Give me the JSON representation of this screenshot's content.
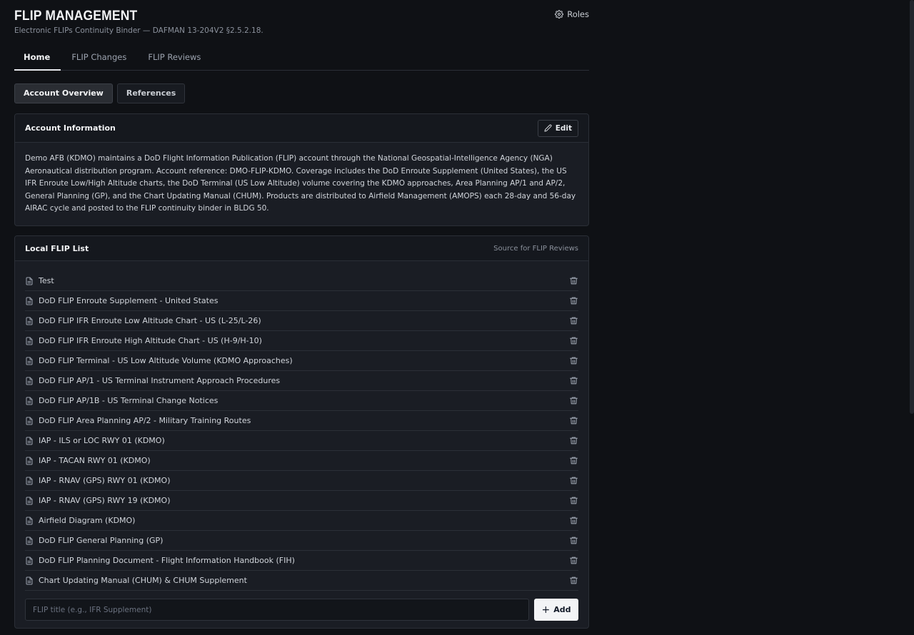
{
  "header": {
    "title": "FLIP MANAGEMENT",
    "subtitle": "Electronic FLIPs Continuity Binder — DAFMAN 13-204V2 §2.5.2.18.",
    "roles_label": "Roles"
  },
  "tabs": [
    {
      "label": "Home",
      "active": true
    },
    {
      "label": "FLIP Changes",
      "active": false
    },
    {
      "label": "FLIP Reviews",
      "active": false
    }
  ],
  "subtabs": [
    {
      "label": "Account Overview",
      "active": true
    },
    {
      "label": "References",
      "active": false
    }
  ],
  "account": {
    "title": "Account Information",
    "edit_label": "Edit",
    "text": "Demo AFB (KDMO) maintains a DoD Flight Information Publication (FLIP) account through the National Geospatial-Intelligence Agency (NGA) Aeronautical distribution program. Account reference: DMO-FLIP-KDMO. Coverage includes the DoD Enroute Supplement (United States), the US IFR Enroute Low/High Altitude charts, the DoD Terminal (US Low Altitude) volume covering the KDMO approaches, Area Planning AP/1 and AP/2, General Planning (GP), and the Chart Updating Manual (CHUM). Products are distributed to Airfield Management (AMOPS) each 28-day and 56-day AIRAC cycle and posted to the FLIP continuity binder in BLDG 50."
  },
  "flip_list": {
    "title": "Local FLIP List",
    "note": "Source for FLIP Reviews",
    "items": [
      "Test",
      "DoD FLIP Enroute Supplement - United States",
      "DoD FLIP IFR Enroute Low Altitude Chart - US (L-25/L-26)",
      "DoD FLIP IFR Enroute High Altitude Chart - US (H-9/H-10)",
      "DoD FLIP Terminal - US Low Altitude Volume (KDMO Approaches)",
      "DoD FLIP AP/1 - US Terminal Instrument Approach Procedures",
      "DoD FLIP AP/1B - US Terminal Change Notices",
      "DoD FLIP Area Planning AP/2 - Military Training Routes",
      "IAP - ILS or LOC RWY 01 (KDMO)",
      "IAP - TACAN RWY 01 (KDMO)",
      "IAP - RNAV (GPS) RWY 01 (KDMO)",
      "IAP - RNAV (GPS) RWY 19 (KDMO)",
      "Airfield Diagram (KDMO)",
      "DoD FLIP General Planning (GP)",
      "DoD FLIP Planning Document - Flight Information Handbook (FIH)",
      "Chart Updating Manual (CHUM) & CHUM Supplement"
    ],
    "input_placeholder": "FLIP title (e.g., IFR Supplement)",
    "input_value": "",
    "add_label": "Add"
  },
  "icons": {
    "roles": "gear-icon",
    "edit": "pencil-icon",
    "item": "document-icon",
    "delete": "trash-icon",
    "add": "plus-icon"
  }
}
